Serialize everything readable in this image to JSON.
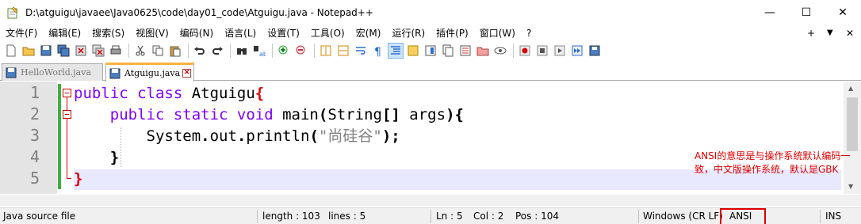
{
  "window": {
    "title": "D:\\atguigu\\javaee\\Java0625\\code\\day01_code\\Atguigu.java - Notepad++",
    "minimize_glyph": "—",
    "maximize_glyph": "☐",
    "close_glyph": "✕"
  },
  "menu": {
    "items": [
      "文件(F)",
      "编辑(E)",
      "搜索(S)",
      "视图(V)",
      "编码(N)",
      "语言(L)",
      "设置(T)",
      "工具(O)",
      "宏(M)",
      "运行(R)",
      "插件(P)",
      "窗口(W)",
      "?"
    ],
    "right_plus": "+",
    "right_dropdown": "▼",
    "right_close": "✕"
  },
  "tabs": [
    {
      "label": "HelloWorld.java",
      "active": false
    },
    {
      "label": "Atguigu.java",
      "active": true
    }
  ],
  "editor": {
    "line_numbers": [
      "1",
      "2",
      "3",
      "4",
      "5"
    ],
    "lines": [
      {
        "tokens": [
          {
            "t": "public class ",
            "c": "kw"
          },
          {
            "t": "Atguigu",
            "c": ""
          },
          {
            "t": "{",
            "c": "brred"
          }
        ]
      },
      {
        "tokens": [
          {
            "t": "    ",
            "c": ""
          },
          {
            "t": "public static void ",
            "c": "kw"
          },
          {
            "t": "main",
            "c": ""
          },
          {
            "t": "(",
            "c": "br"
          },
          {
            "t": "String",
            "c": ""
          },
          {
            "t": "[]",
            "c": "br"
          },
          {
            "t": " args",
            "c": ""
          },
          {
            "t": "){",
            "c": "br"
          }
        ]
      },
      {
        "tokens": [
          {
            "t": "        System",
            "c": ""
          },
          {
            "t": ".",
            "c": "br"
          },
          {
            "t": "out",
            "c": ""
          },
          {
            "t": ".",
            "c": "br"
          },
          {
            "t": "println",
            "c": ""
          },
          {
            "t": "(",
            "c": "br"
          },
          {
            "t": "\"尚硅谷\"",
            "c": "str"
          },
          {
            "t": ");",
            "c": "br"
          }
        ]
      },
      {
        "tokens": [
          {
            "t": "    ",
            "c": ""
          },
          {
            "t": "}",
            "c": "br"
          }
        ]
      },
      {
        "tokens": [
          {
            "t": "}",
            "c": "brred"
          }
        ]
      }
    ]
  },
  "annotation": {
    "text": "ANSI的意思是与操作系统默认编码一致，中文版操作系统，默认是GBK"
  },
  "status": {
    "file_type": "Java source file",
    "length": "length : 103",
    "lines": "lines : 5",
    "ln": "Ln : 5",
    "col": "Col : 2",
    "pos": "Pos : 104",
    "eol": "Windows (CR LF)",
    "encoding": "ANSI",
    "mode": "INS"
  },
  "colors": {
    "keyword": "#8000ff",
    "string": "#808080",
    "current_line": "#e8e8ff",
    "change_bar": "#3cb043",
    "annotation": "#e00000"
  }
}
